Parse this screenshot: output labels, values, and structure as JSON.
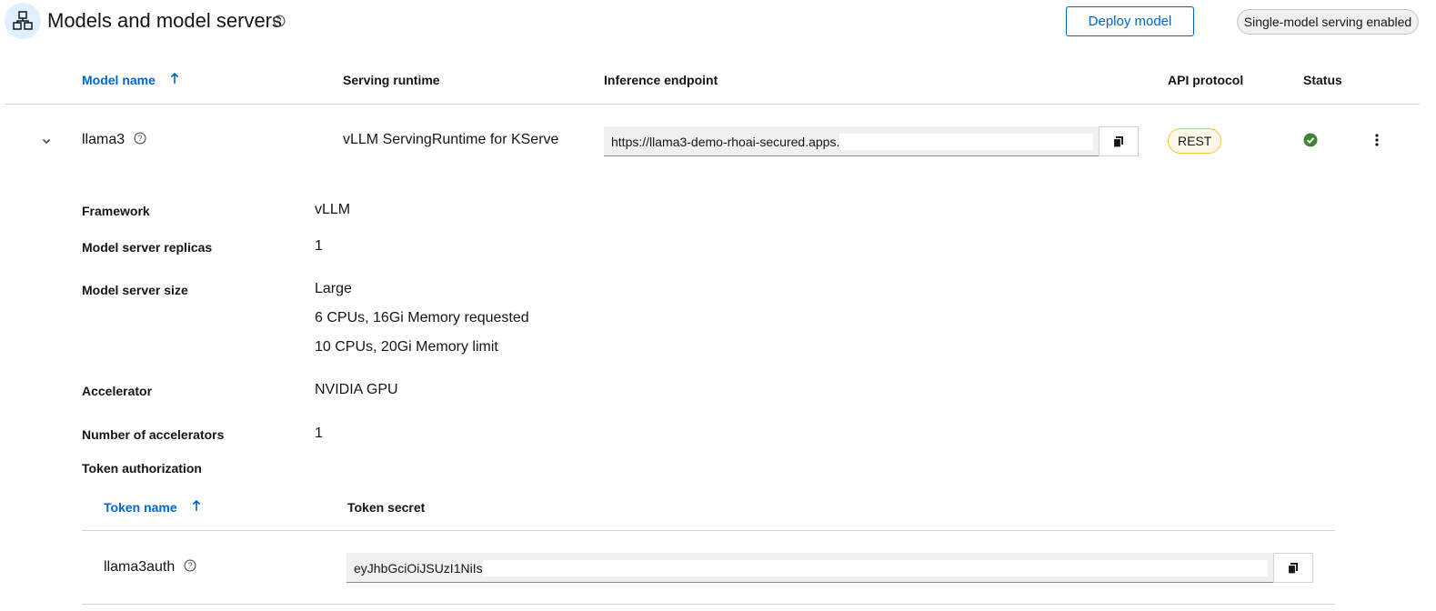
{
  "header": {
    "title": "Models and model servers",
    "icon": "models-icon",
    "deploy_label": "Deploy model",
    "serving_label": "Single-model serving enabled"
  },
  "table": {
    "columns": {
      "model_name": "Model name",
      "serving_runtime": "Serving runtime",
      "inference_endpoint": "Inference endpoint",
      "api_protocol": "API protocol",
      "status": "Status"
    },
    "row": {
      "model_name": "llama3",
      "serving_runtime": "vLLM ServingRuntime for KServe",
      "inference_endpoint": "https://llama3-demo-rhoai-secured.apps.",
      "api_protocol": "REST",
      "status": "success",
      "status_color": "#3e8635"
    }
  },
  "details": {
    "framework_label": "Framework",
    "framework_value": "vLLM",
    "replicas_label": "Model server replicas",
    "replicas_value": "1",
    "size_label": "Model server size",
    "size_value": "Large",
    "size_requested": "6 CPUs, 16Gi Memory requested",
    "size_limit": "10 CPUs, 20Gi Memory limit",
    "accelerator_label": "Accelerator",
    "accelerator_value": "NVIDIA GPU",
    "num_accelerators_label": "Number of accelerators",
    "num_accelerators_value": "1",
    "token_auth_label": "Token authorization"
  },
  "tokens": {
    "columns": {
      "name": "Token name",
      "secret": "Token secret"
    },
    "row": {
      "name": "llama3auth",
      "secret": "eyJhbGciOiJSUzI1NiIs"
    }
  },
  "colors": {
    "link": "#0066cc",
    "badge_border": "#f4c145",
    "success": "#3e8635"
  }
}
